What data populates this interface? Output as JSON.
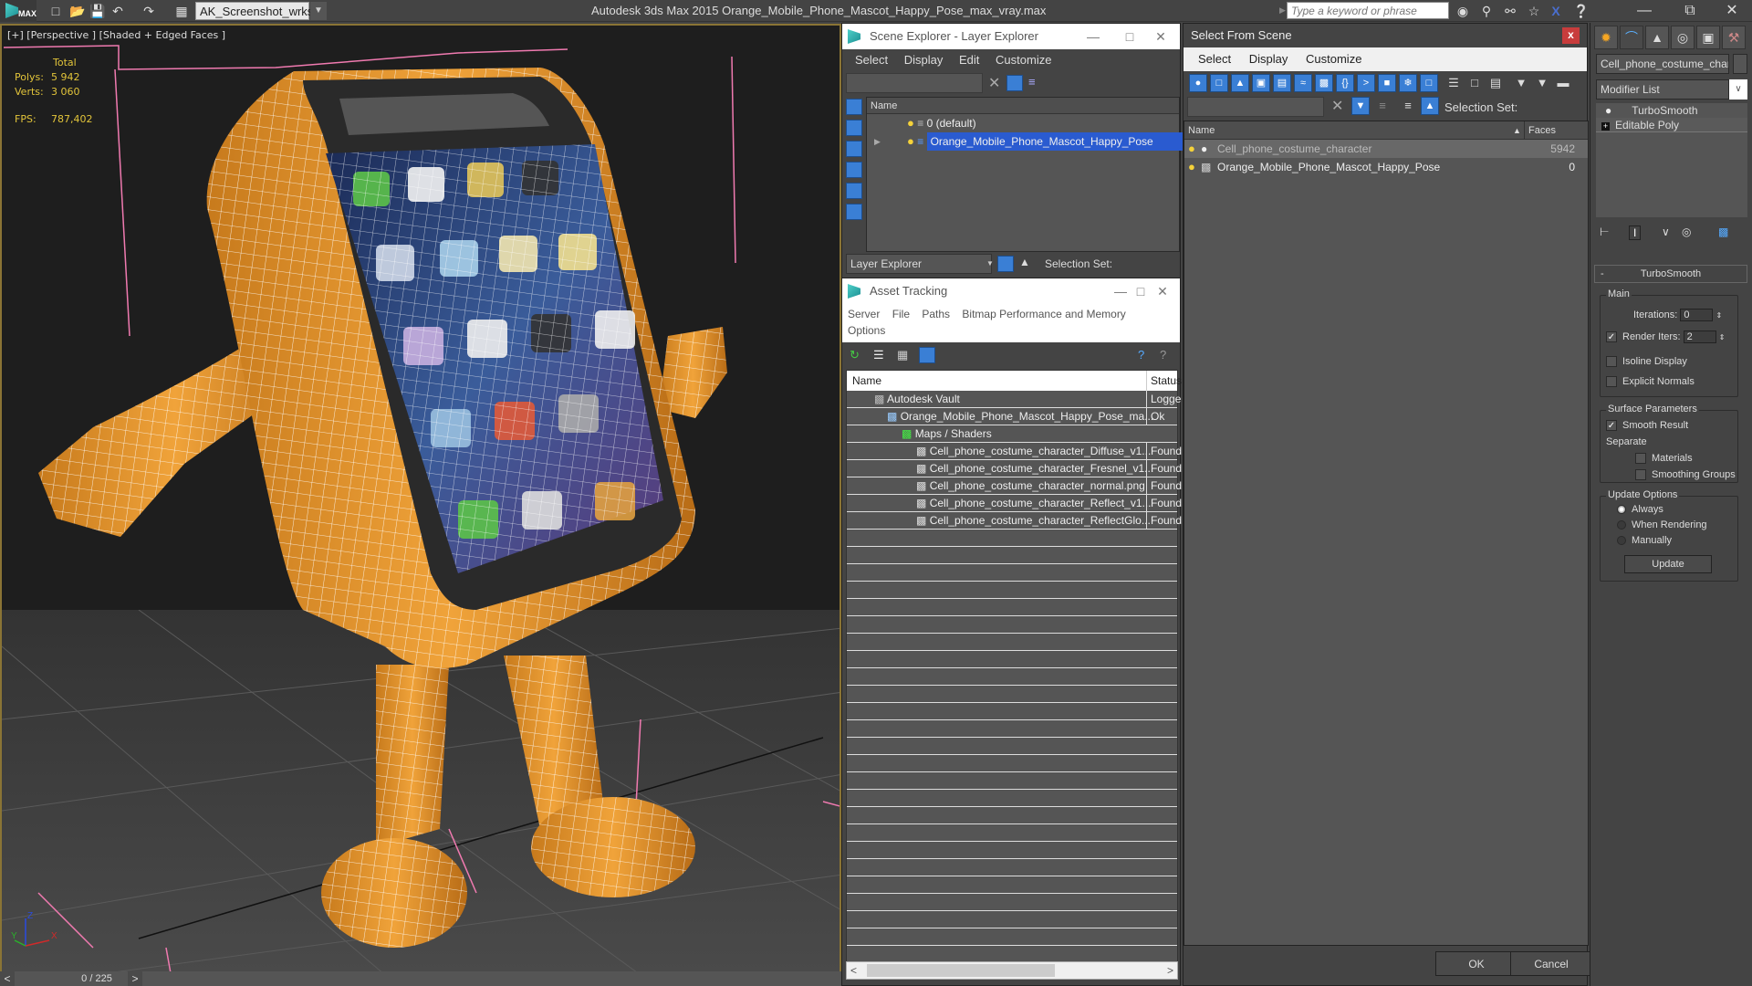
{
  "titlebar": {
    "app_title": "Autodesk 3ds Max  2015    Orange_Mobile_Phone_Mascot_Happy_Pose_max_vray.max",
    "logo_text": "MAX",
    "workspace": "AK_Screenshot_wrksp",
    "search_placeholder": "Type a keyword or phrase",
    "icons": [
      "new-file-icon",
      "open-file-icon",
      "save-icon",
      "undo-icon",
      "redo-icon",
      "project-folder-icon"
    ],
    "right_icons": [
      "binoculars-icon",
      "key-icon",
      "satellite-icon",
      "star-icon",
      "x-icon",
      "help-icon"
    ]
  },
  "viewport": {
    "label": "[+] [Perspective ] [Shaded + Edged Faces ]",
    "stats": {
      "total_label": "Total",
      "polys_label": "Polys:",
      "polys_value": "5 942",
      "verts_label": "Verts:",
      "verts_value": "3 060",
      "fps_label": "FPS:",
      "fps_value": "787,402"
    },
    "axis": {
      "x": "X",
      "y": "Y",
      "z": "Z"
    }
  },
  "timeline": {
    "frame": "0 / 225",
    "prev": "<",
    "next": ">"
  },
  "scene_explorer": {
    "title": "Scene Explorer - Layer Explorer",
    "menu": [
      "Select",
      "Display",
      "Edit",
      "Customize"
    ],
    "column": "Name",
    "rows": [
      {
        "label": "0 (default)",
        "selected": false
      },
      {
        "label": "Orange_Mobile_Phone_Mascot_Happy_Pose",
        "selected": true
      }
    ],
    "explorer_dropdown": "Layer Explorer",
    "selection_set_label": "Selection Set:"
  },
  "asset_tracking": {
    "title": "Asset Tracking",
    "menu": [
      "Server",
      "File",
      "Paths",
      "Bitmap Performance and Memory",
      "Options"
    ],
    "columns": [
      "Name",
      "Status"
    ],
    "rows": [
      {
        "name": "Autodesk Vault",
        "status": "Logge",
        "indent": 1,
        "icon": "vault-icon"
      },
      {
        "name": "Orange_Mobile_Phone_Mascot_Happy_Pose_ma...",
        "status": "Ok",
        "indent": 2,
        "icon": "max-file-icon"
      },
      {
        "name": "Maps / Shaders",
        "status": "",
        "indent": 3,
        "icon": "maps-icon"
      },
      {
        "name": "Cell_phone_costume_character_Diffuse_v1...",
        "status": "Found",
        "indent": 4,
        "icon": "bitmap-icon"
      },
      {
        "name": "Cell_phone_costume_character_Fresnel_v1...",
        "status": "Found",
        "indent": 4,
        "icon": "bitmap-icon"
      },
      {
        "name": "Cell_phone_costume_character_normal.png",
        "status": "Found",
        "indent": 4,
        "icon": "bitmap-icon"
      },
      {
        "name": "Cell_phone_costume_character_Reflect_v1...",
        "status": "Found",
        "indent": 4,
        "icon": "bitmap-icon"
      },
      {
        "name": "Cell_phone_costume_character_ReflectGlo...",
        "status": "Found",
        "indent": 4,
        "icon": "bitmap-icon"
      }
    ]
  },
  "select_from_scene": {
    "title": "Select From Scene",
    "close": "x",
    "menu": [
      "Select",
      "Display",
      "Customize"
    ],
    "selection_set_label": "Selection Set:",
    "columns": [
      "Name",
      "Faces"
    ],
    "rows": [
      {
        "name": "Cell_phone_costume_character",
        "faces": "5942",
        "selected": true
      },
      {
        "name": "Orange_Mobile_Phone_Mascot_Happy_Pose",
        "faces": "0",
        "selected": false
      }
    ],
    "ok": "OK",
    "cancel": "Cancel"
  },
  "command_panel": {
    "object_name": "Cell_phone_costume_charact",
    "modifier_list": "Modifier List",
    "stack": [
      "TurboSmooth",
      "Editable Poly"
    ],
    "rollout_title": "TurboSmooth",
    "rollout_collapse": "-",
    "main_group": "Main",
    "iterations_label": "Iterations:",
    "iterations_value": "0",
    "render_iters_label": "Render Iters:",
    "render_iters_value": "2",
    "render_iters_checked": true,
    "isoline_label": "Isoline Display",
    "explicit_normals_label": "Explicit Normals",
    "surface_group": "Surface Parameters",
    "smooth_result_label": "Smooth Result",
    "separate_label": "Separate",
    "materials_label": "Materials",
    "smoothing_groups_label": "Smoothing Groups",
    "update_group": "Update Options",
    "update_options": [
      "Always",
      "When Rendering",
      "Manually"
    ],
    "update_selected": "Always",
    "update_button": "Update"
  },
  "colors": {
    "mascot_orange": "#e8952a",
    "selection_blue": "#2a5bd0",
    "stats_yellow": "#e2c43a",
    "viewport_border": "#8a7435"
  }
}
